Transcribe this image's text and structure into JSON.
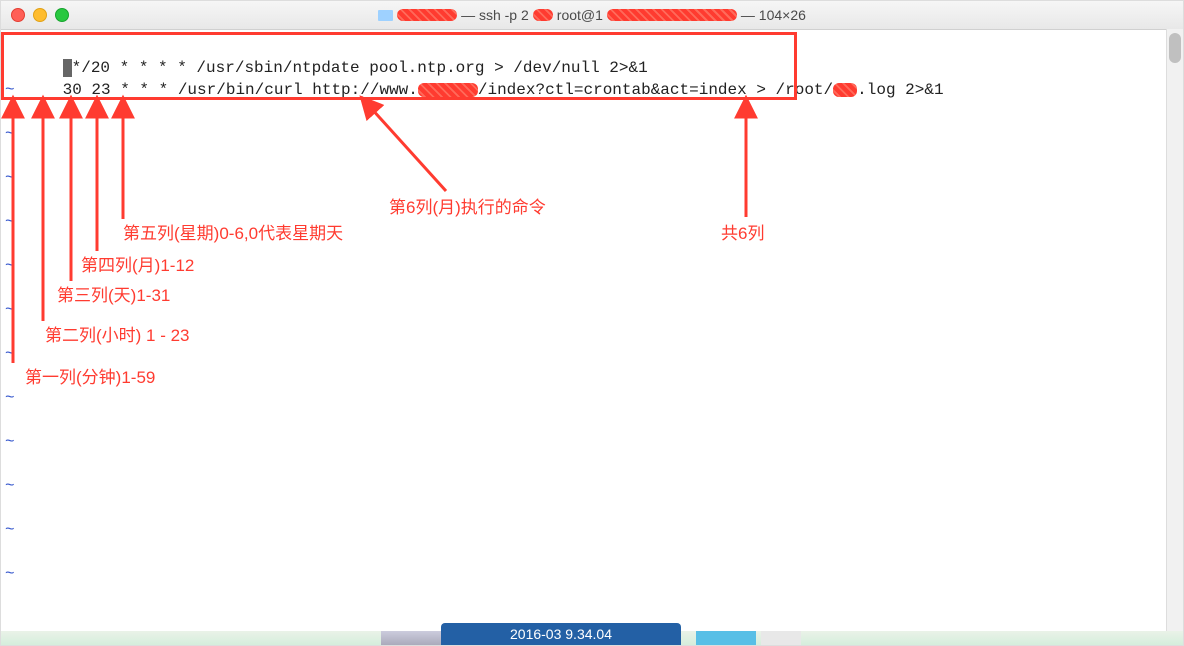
{
  "titlebar": {
    "title_part1": " — ssh -p 2",
    "title_part2": " root@1",
    "title_part3": "— 104×26"
  },
  "term": {
    "line1": "*/20 * * * * /usr/sbin/ntpdate pool.ntp.org > /dev/null 2>&1",
    "line2a": "30 23 * * * /usr/bin/curl http://www.",
    "line2b": "/index?ctl=crontab&act=index",
    "line2c": " > /root/",
    "line2d": ".log 2>&1",
    "tilde": "~"
  },
  "annotations": {
    "col1": "第一列(分钟)1-59",
    "col2": "第二列(小时) 1 - 23",
    "col3": "第三列(天)1-31",
    "col4": "第四列(月)1-12",
    "col5": "第五列(星期)0-6,0代表星期天",
    "col6": "第6列(月)执行的命令",
    "total": "共6列"
  },
  "bottom": {
    "datetime": "2016-03    9.34.04"
  }
}
